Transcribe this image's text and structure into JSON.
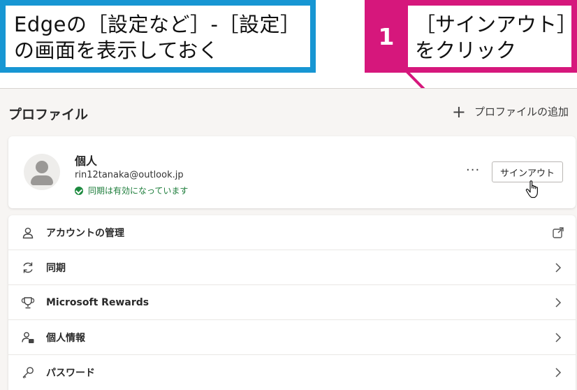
{
  "callouts": {
    "left": {
      "line1": "Edgeの［設定など］-［設定］",
      "line2": "の画面を表示しておく"
    },
    "right": {
      "step": "1",
      "line1": "［サインアウト］",
      "line2": "をクリック"
    }
  },
  "profile": {
    "section_title": "プロファイル",
    "add_profile_label": "プロファイルの追加",
    "name": "個人",
    "email": "rin12tanaka@outlook.jp",
    "sync_status": "同期は有効になっています",
    "more_label": "···",
    "signout_label": "サインアウト"
  },
  "menu": {
    "items": [
      {
        "label": "アカウントの管理",
        "icon": "person-icon",
        "end": "external-link-icon"
      },
      {
        "label": "同期",
        "icon": "sync-icon",
        "end": "chevron-right-icon"
      },
      {
        "label": "Microsoft Rewards",
        "icon": "trophy-icon",
        "end": "chevron-right-icon"
      },
      {
        "label": "個人情報",
        "icon": "person-card-icon",
        "end": "chevron-right-icon"
      },
      {
        "label": "パスワード",
        "icon": "key-icon",
        "end": "chevron-right-icon"
      }
    ]
  },
  "colors": {
    "callout_blue": "#1796d3",
    "callout_pink": "#d6177c",
    "sync_green": "#1d7d3b"
  }
}
